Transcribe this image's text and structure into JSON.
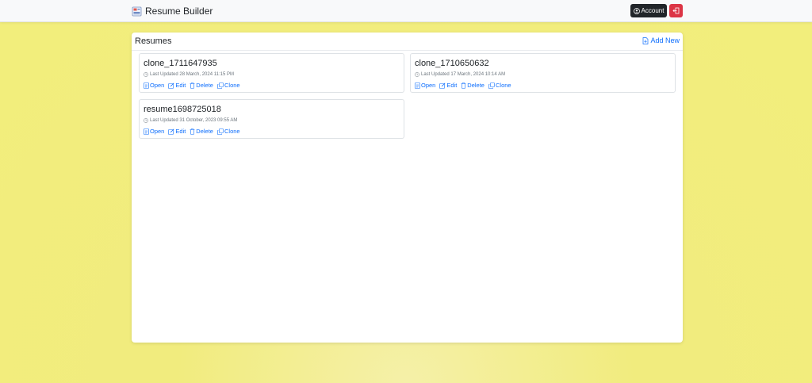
{
  "app": {
    "title": "Resume Builder",
    "account_label": "Account"
  },
  "main": {
    "title": "Resumes",
    "add_new_label": "Add New"
  },
  "resumes": [
    {
      "name": "clone_1711647935",
      "last_updated": "Last Updated 28 March, 2024 11:15 PM"
    },
    {
      "name": "clone_1710650632",
      "last_updated": "Last Updated 17 March, 2024 10:14 AM"
    },
    {
      "name": "resume1698725018",
      "last_updated": "Last Updated 31 October, 2023 09:55 AM"
    }
  ],
  "actions": {
    "open": "Open",
    "edit": "Edit",
    "delete": "Delete",
    "clone": "Clone"
  },
  "colors": {
    "accent": "#0d6efd",
    "danger": "#dc3545",
    "dark": "#212529",
    "background": "#f2ee7c"
  }
}
